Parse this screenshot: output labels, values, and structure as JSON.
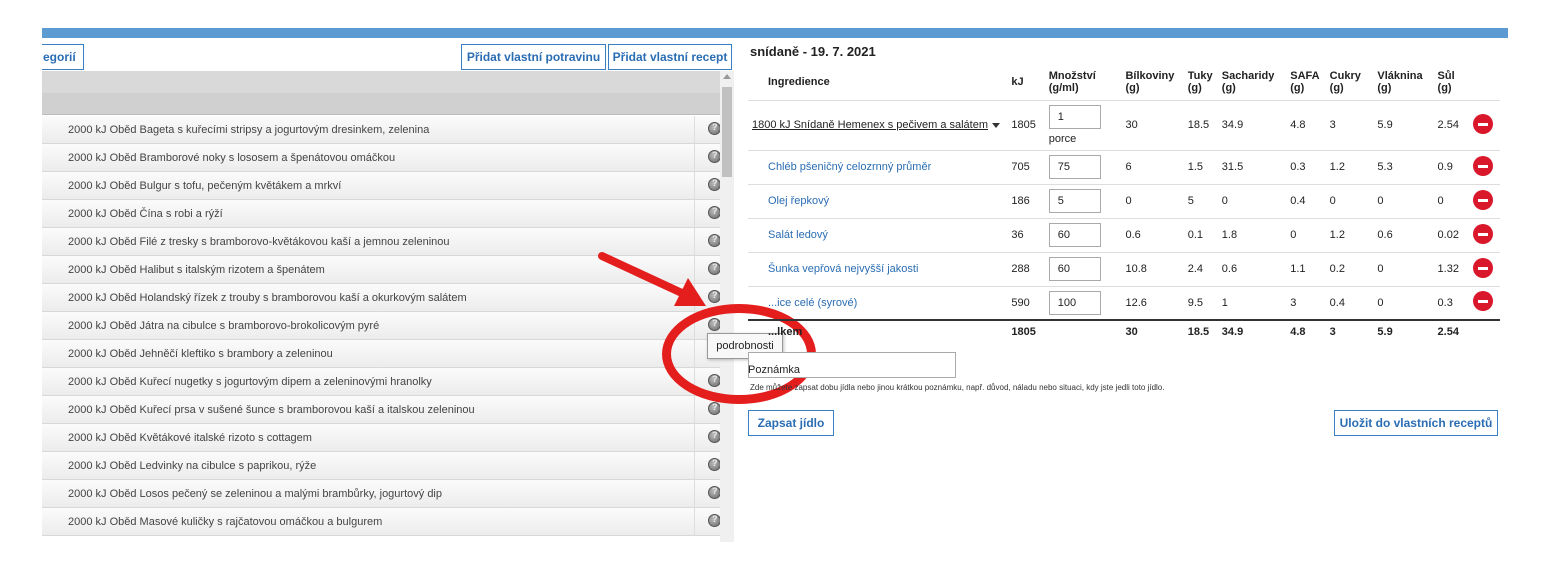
{
  "left_panel": {
    "categories_button": "egorií",
    "add_food_button": "Přidat vlastní potravinu",
    "add_recipe_button": "Přidat vlastní recept",
    "items": [
      "2000 kJ Oběd Bageta s kuřecími stripsy a jogurtovým dresinkem, zelenina",
      "2000 kJ Oběd Bramborové noky s lososem a špenátovou omáčkou",
      "2000 kJ Oběd Bulgur s tofu, pečeným květákem a mrkví",
      "2000 kJ Oběd Čína s robi a rýží",
      "2000 kJ Oběd Filé z tresky s bramborovo-květákovou kaší a jemnou zeleninou",
      "2000 kJ Oběd Halibut s italským rizotem a špenátem",
      "2000 kJ Oběd Holandský řízek z trouby s bramborovou kaší a okurkovým salátem",
      "2000 kJ Oběd Játra na cibulce s bramborovo-brokolicovým pyré",
      "2000 kJ Oběd Jehněčí kleftiko s brambory a zeleninou",
      "2000 kJ Oběd Kuřecí nugetky s jogurtovým dipem a zeleninovými hranolky",
      "2000 kJ Oběd Kuřecí prsa v sušené šunce s bramborovou kaší a italskou zeleninou",
      "2000 kJ Oběd Květákové italské rizoto s cottagem",
      "2000 kJ Oběd Ledvinky na cibulce s paprikou, rýže",
      "2000 kJ Oběd Losos pečený se zeleninou a malými brambůrky, jogurtový dip",
      "2000 kJ Oběd Masové kuličky s rajčatovou omáčkou a bulgurem"
    ],
    "tooltip": "podrobnosti"
  },
  "right_panel": {
    "meal_title": "snídaně - 19. 7. 2021",
    "headers": {
      "ingredient": "Ingredience",
      "kj": "kJ",
      "amount": "Množství (g/ml)",
      "protein": "Bílkoviny (g)",
      "fat": "Tuky (g)",
      "carbs": "Sacharidy (g)",
      "safa": "SAFA (g)",
      "sugar": "Cukry (g)",
      "fiber": "Vláknina (g)",
      "salt": "Sůl (g)"
    },
    "main_row": {
      "name": "1800 kJ Snídaně Hemenex s pečivem a salátem",
      "kj": "1805",
      "amount": "1",
      "unit": "porce",
      "protein": "30",
      "fat": "18.5",
      "carbs": "34.9",
      "safa": "4.8",
      "sugar": "3",
      "fiber": "5.9",
      "salt": "2.54"
    },
    "rows": [
      {
        "name": "Chléb pšeničný celozrnný průměr",
        "kj": "705",
        "amount": "75",
        "protein": "6",
        "fat": "1.5",
        "carbs": "31.5",
        "safa": "0.3",
        "sugar": "1.2",
        "fiber": "5.3",
        "salt": "0.9"
      },
      {
        "name": "Olej řepkový",
        "kj": "186",
        "amount": "5",
        "protein": "0",
        "fat": "5",
        "carbs": "0",
        "safa": "0.4",
        "sugar": "0",
        "fiber": "0",
        "salt": "0"
      },
      {
        "name": "Salát ledový",
        "kj": "36",
        "amount": "60",
        "protein": "0.6",
        "fat": "0.1",
        "carbs": "1.8",
        "safa": "0",
        "sugar": "1.2",
        "fiber": "0.6",
        "salt": "0.02"
      },
      {
        "name": "Šunka vepřová nejvyšší jakosti",
        "kj": "288",
        "amount": "60",
        "protein": "10.8",
        "fat": "2.4",
        "carbs": "0.6",
        "safa": "1.1",
        "sugar": "0.2",
        "fiber": "0",
        "salt": "1.32"
      },
      {
        "name": "...ice celé (syrové)",
        "kj": "590",
        "amount": "100",
        "protein": "12.6",
        "fat": "9.5",
        "carbs": "1",
        "safa": "3",
        "sugar": "0.4",
        "fiber": "0",
        "salt": "0.3"
      }
    ],
    "total": {
      "label": "...lkem",
      "kj": "1805",
      "protein": "30",
      "fat": "18.5",
      "carbs": "34.9",
      "safa": "4.8",
      "sugar": "3",
      "fiber": "5.9",
      "salt": "2.54"
    },
    "note_label": "Poznámka",
    "note_help": "Zde můžete zapsat dobu jídla nebo jinou krátkou poznámku, např. důvod, náladu nebo situaci, kdy jste jedli toto jídlo.",
    "save_button": "Zapsat jídlo",
    "save_recipe_button": "Uložit do vlastních receptů"
  },
  "colors": {
    "accent": "#5b9bd1",
    "link": "#2a6db3",
    "remove": "#d9182b",
    "annotation": "#e41d1d"
  }
}
